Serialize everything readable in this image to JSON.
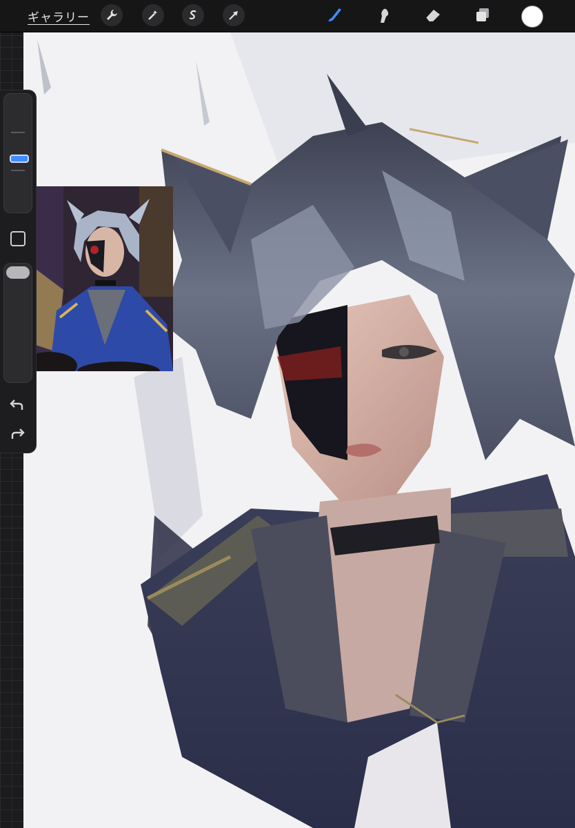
{
  "toolbar": {
    "gallery_label": "ギャラリー",
    "left_tools": [
      "wrench-icon",
      "magic-wand-icon",
      "selection-s-icon",
      "transform-arrow-icon"
    ],
    "right_tools": [
      "brush-icon",
      "smudge-icon",
      "eraser-icon",
      "layers-icon"
    ],
    "active_tool": "brush-icon",
    "active_color": "#ffffff",
    "accent_color": "#3e8cff"
  },
  "sidebar": {
    "brush_size": 0.5,
    "opacity": 1.0,
    "controls": [
      "brush-size-slider",
      "modify-button",
      "opacity-slider",
      "undo-icon",
      "redo-icon"
    ]
  },
  "canvas": {
    "background": "#f2f2f4",
    "reference_image": "reference-photo"
  }
}
